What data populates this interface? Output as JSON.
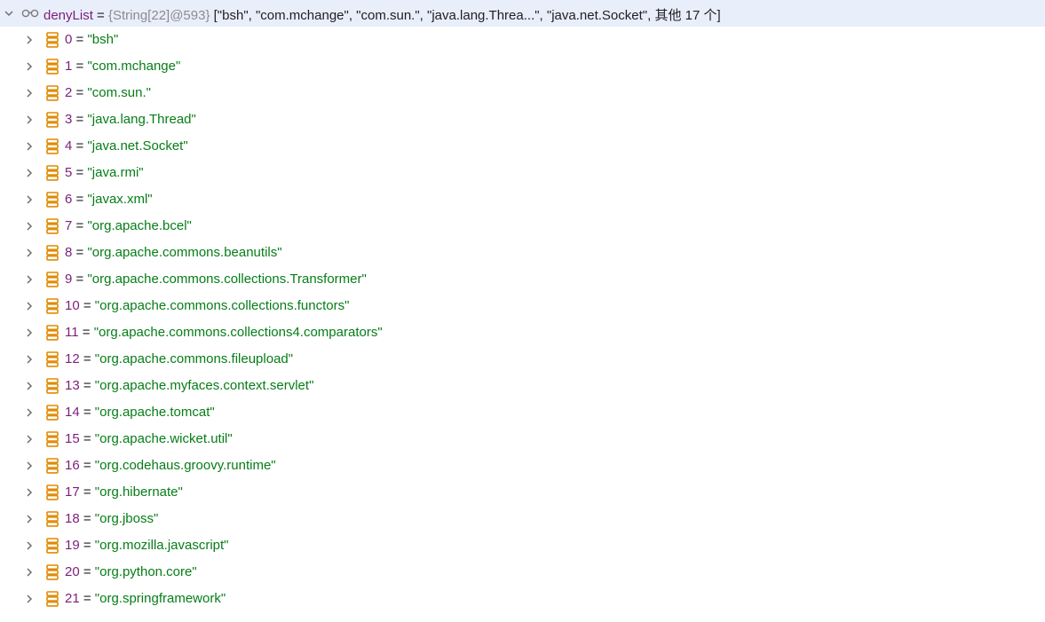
{
  "header": {
    "variable_name": "denyList",
    "equals": " = ",
    "type_ref": "{String[22]@593}",
    "summary": " [\"bsh\", \"com.mchange\", \"com.sun.\", \"java.lang.Threa...\", \"java.net.Socket\", 其他 17 个]",
    "chevron_icon": "chevron-down-icon",
    "watch_icon": "glasses-icon"
  },
  "items": [
    {
      "index": "0",
      "value": "\"bsh\""
    },
    {
      "index": "1",
      "value": "\"com.mchange\""
    },
    {
      "index": "2",
      "value": "\"com.sun.\""
    },
    {
      "index": "3",
      "value": "\"java.lang.Thread\""
    },
    {
      "index": "4",
      "value": "\"java.net.Socket\""
    },
    {
      "index": "5",
      "value": "\"java.rmi\""
    },
    {
      "index": "6",
      "value": "\"javax.xml\""
    },
    {
      "index": "7",
      "value": "\"org.apache.bcel\""
    },
    {
      "index": "8",
      "value": "\"org.apache.commons.beanutils\""
    },
    {
      "index": "9",
      "value": "\"org.apache.commons.collections.Transformer\""
    },
    {
      "index": "10",
      "value": "\"org.apache.commons.collections.functors\""
    },
    {
      "index": "11",
      "value": "\"org.apache.commons.collections4.comparators\""
    },
    {
      "index": "12",
      "value": "\"org.apache.commons.fileupload\""
    },
    {
      "index": "13",
      "value": "\"org.apache.myfaces.context.servlet\""
    },
    {
      "index": "14",
      "value": "\"org.apache.tomcat\""
    },
    {
      "index": "15",
      "value": "\"org.apache.wicket.util\""
    },
    {
      "index": "16",
      "value": "\"org.codehaus.groovy.runtime\""
    },
    {
      "index": "17",
      "value": "\"org.hibernate\""
    },
    {
      "index": "18",
      "value": "\"org.jboss\""
    },
    {
      "index": "19",
      "value": "\"org.mozilla.javascript\""
    },
    {
      "index": "20",
      "value": "\"org.python.core\""
    },
    {
      "index": "21",
      "value": "\"org.springframework\""
    }
  ],
  "item_eq": " = ",
  "item_icon": "array-element-icon",
  "item_chevron_icon": "chevron-right-icon",
  "colors": {
    "header_bg": "#e9eefb",
    "variable": "#7a1f7a",
    "string": "#067d17",
    "type_ref": "#8c8c8c",
    "icon": "#e08a00"
  }
}
